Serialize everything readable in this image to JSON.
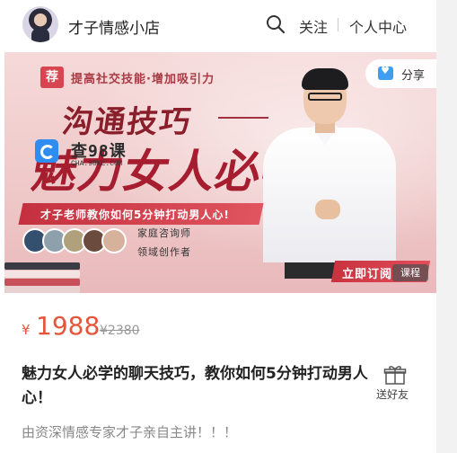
{
  "header": {
    "shop_name": "才子情感小店",
    "follow_label": "关注",
    "user_center_label": "个人中心"
  },
  "banner": {
    "tag": "荐",
    "tagline": "提高社交技能·增加吸引力",
    "title_line1": "沟通技巧",
    "title_line2": "魅力女人必学",
    "watermark_text": "查98课",
    "watermark_url": "CHA.98KE.COM",
    "ribbon_text": "才子老师教你如何5分钟打动男人心!",
    "role_1": "家庭咨询师",
    "role_2": "领域创作者",
    "buy_label": "立即订阅",
    "course_badge": "课程",
    "share_label": "分享"
  },
  "product": {
    "currency_symbol": "¥",
    "price": "1988",
    "original_price": "¥2380",
    "title": "魅力女人必学的聊天技巧，教你如何5分钟打动男人心！",
    "gift_label": "送好友",
    "description": "由资深情感专家才子亲自主讲！！！"
  },
  "colors": {
    "price": "#e4553a",
    "banner_red": "#a51d2e",
    "banner_bg": "#efc9c9"
  }
}
